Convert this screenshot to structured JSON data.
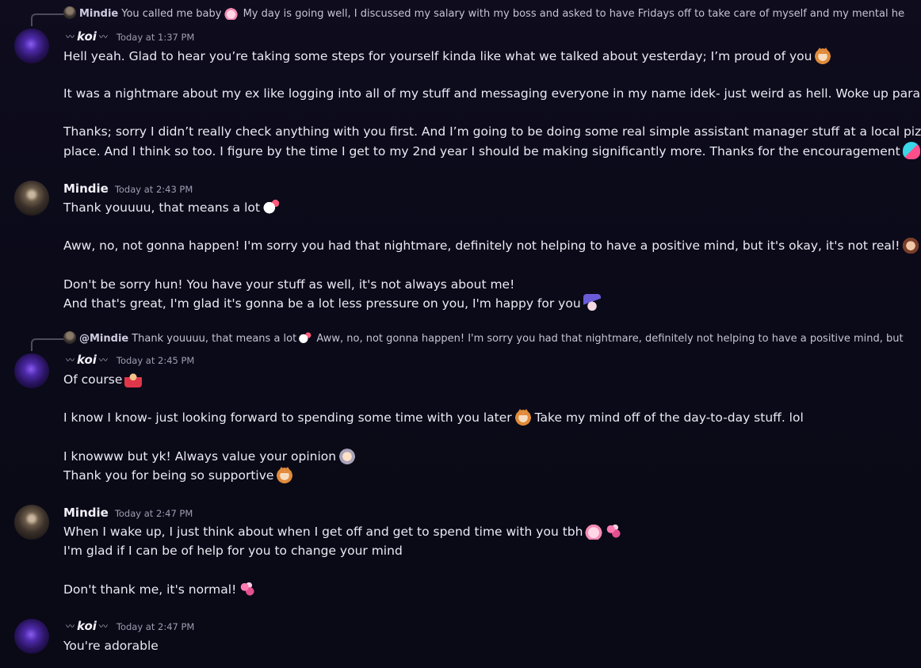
{
  "messages": [
    {
      "reply": {
        "author": "Mindie",
        "text": "You called me baby",
        "text2": "My day is going well, I discussed my salary with my boss and asked to have Fridays off to take care of myself and my mental heal"
      },
      "author": "koi",
      "timestamp": "Today at 1:37 PM",
      "lines": [
        "Hell yeah. Glad to hear you’re taking some steps for yourself kinda like what we talked about yesterday; I’m proud of you",
        "It was a nightmare about my ex like logging into all of my stuff and messaging everyone in my name idek- just weird as hell. Woke up paranoid.",
        "Thanks; sorry I didn’t really check anything with you first. And I’m going to be doing some real simple assistant manager stuff at a local pizza",
        "place. And I think so too. I figure by the time I get to my 2nd year I should be making significantly more. Thanks for the encouragement"
      ]
    },
    {
      "author": "Mindie",
      "timestamp": "Today at 2:43 PM",
      "lines": [
        "Thank youuuu, that means a lot",
        "Aww, no, not gonna happen! I'm sorry you had that nightmare, definitely not helping to have a positive mind, but it's okay, it's not real!",
        "Don't be sorry hun! You have your stuff as well, it's not always about me!",
        "And that's great, I'm glad it's gonna be a lot less pressure on you, I'm happy for you"
      ]
    },
    {
      "reply": {
        "author": "@Mindie",
        "text": "Thank youuuu, that means a lot",
        "text2": "Aww, no, not gonna happen! I'm sorry you had that nightmare, definitely not helping to have a positive mind, but it"
      },
      "author": "koi",
      "timestamp": "Today at 2:45 PM",
      "lines": [
        "Of course",
        "I know I know- just looking forward to spending some time with you later",
        "Take my mind off of the day-to-day stuff. lol",
        "I knowww but yk! Always value your opinion",
        "Thank you for being so supportive"
      ]
    },
    {
      "author": "Mindie",
      "timestamp": "Today at 2:47 PM",
      "lines": [
        "When I wake up, I just think about when I get off and get to spend time with you tbh",
        "I'm glad if I can be of help for you to change your mind",
        "Don't thank me, it's normal!"
      ]
    },
    {
      "author": "koi",
      "timestamp": "Today at 2:47 PM",
      "lines": [
        "You're adorable"
      ]
    }
  ],
  "icons": {
    "name_decoration": "feather-icon",
    "koi_avatar": "purple-night-avatar",
    "mindie_avatar": "photo-avatar"
  },
  "colors": {
    "background": "#0e0c1d",
    "text": "#ebe9f3",
    "timestamp": "#a09cb2",
    "reply_spine": "#4e4c5c"
  }
}
